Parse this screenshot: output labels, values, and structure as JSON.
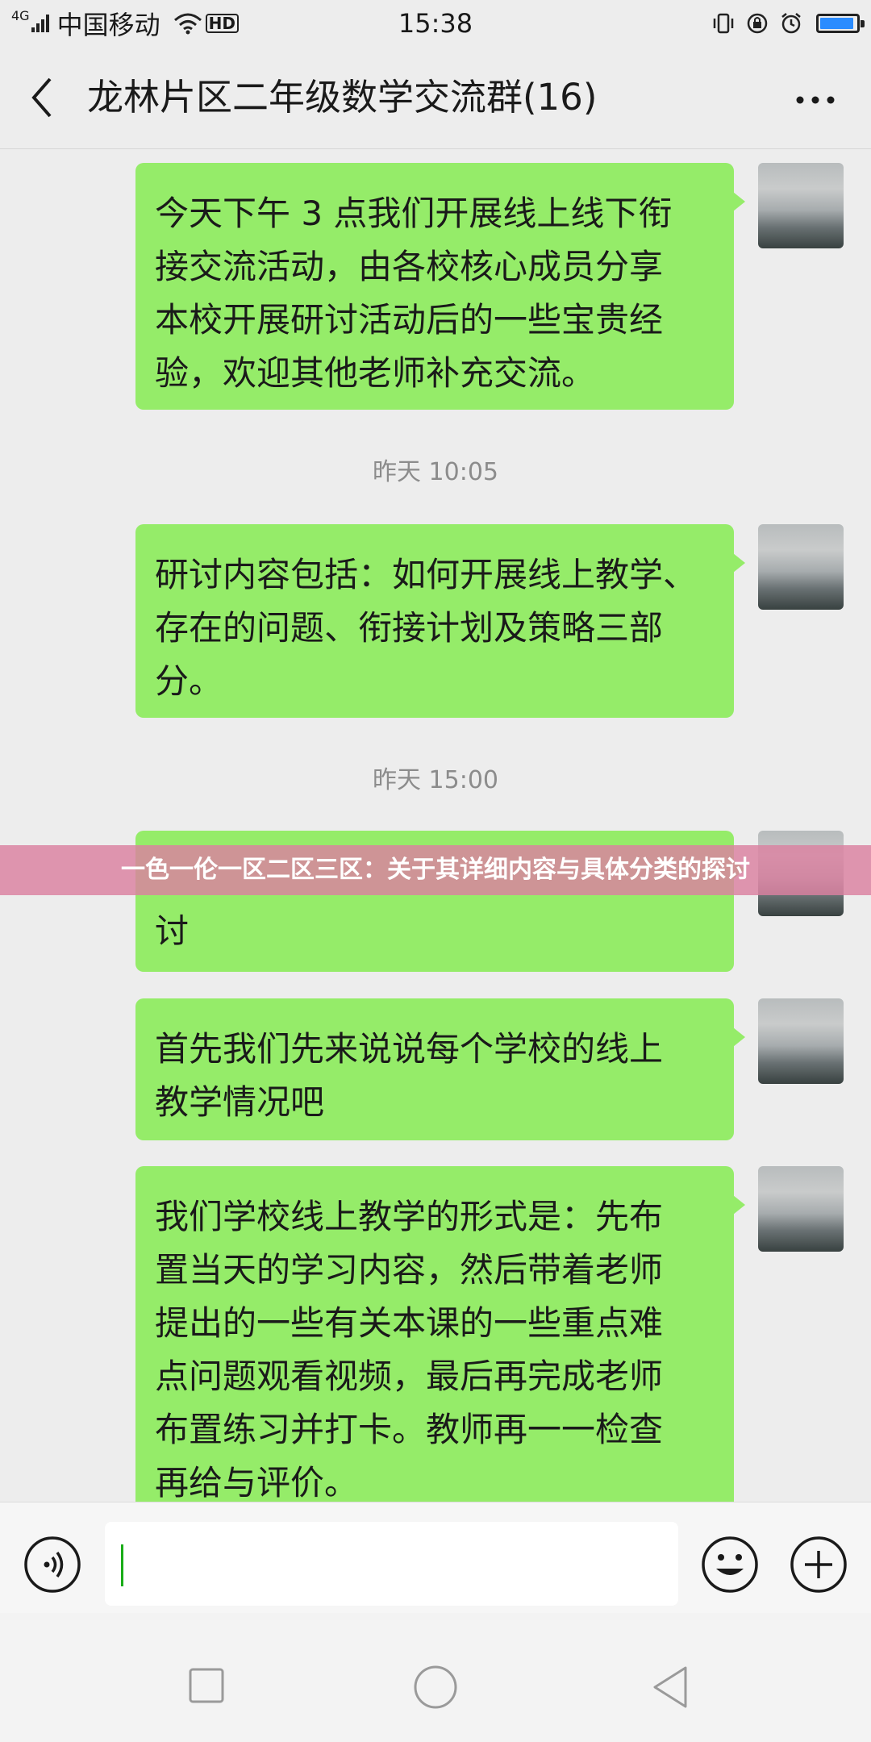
{
  "status_bar": {
    "network_type": "4G",
    "carrier": "中国移动",
    "hd_label": "HD",
    "time": "15:38",
    "battery_level": 0.85
  },
  "header": {
    "title": "龙林片区二年级数学交流群(16)"
  },
  "messages": [
    {
      "type": "text",
      "text": "今天下午 3 点我们开展线上线下衔\n接交流活动，由各校核心成员分享\n本校开展研讨活动后的一些宝贵经\n验，欢迎其他老师补充交流。"
    },
    {
      "type": "time",
      "text": "昨天 10:05"
    },
    {
      "type": "text",
      "text": "研讨内容包括：如何开展线上教学、\n存在的问题、衔接计划及策略三部\n分。"
    },
    {
      "type": "time",
      "text": "昨天 15:00"
    },
    {
      "type": "text",
      "text": "\n讨"
    },
    {
      "type": "text",
      "text": "首先我们先来说说每个学校的线上\n教学情况吧"
    },
    {
      "type": "text",
      "text": "我们学校线上教学的形式是：先布\n置当天的学习内容，然后带着老师\n提出的一些有关本课的一些重点难\n点问题观看视频，最后再完成老师\n布置练习并打卡。教师再一一检查\n再给与评价。"
    }
  ],
  "overlay_banner": "一色一伦一区二区三区：关于其详细内容与具体分类的探讨",
  "input": {
    "value": ""
  },
  "colors": {
    "bubble": "#95ec69",
    "background": "#ededed",
    "banner": "#da80a0"
  }
}
